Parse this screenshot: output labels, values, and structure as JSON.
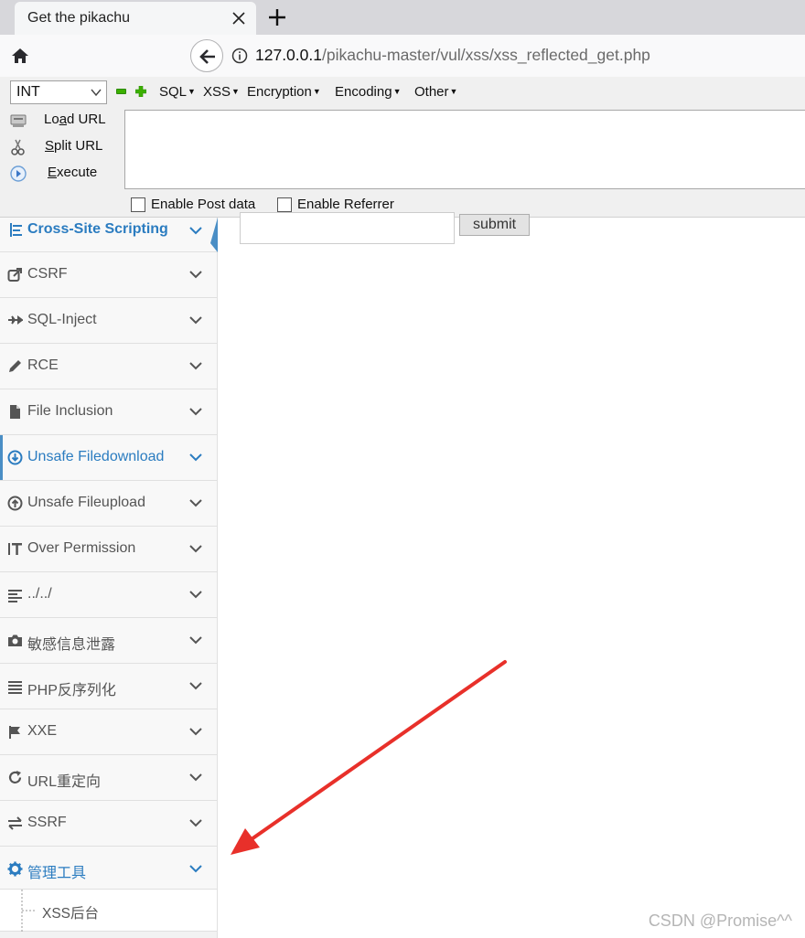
{
  "browser": {
    "tab_title": "Get the pikachu",
    "url_host": "127.0.0.1",
    "url_path": "/pikachu-master/vul/xss/xss_reflected_get.php"
  },
  "hackbar": {
    "select_value": "INT",
    "menus": [
      "SQL",
      "XSS",
      "Encryption",
      "Encoding",
      "Other"
    ],
    "actions": {
      "load_url_pre": "Lo",
      "load_url_u": "a",
      "load_url_post": "d URL",
      "split_url_u": "S",
      "split_url_post": "plit URL",
      "execute_u": "E",
      "execute_post": "xecute"
    },
    "enable_post": "Enable Post data",
    "enable_referrer": "Enable Referrer"
  },
  "sidebar": {
    "items": [
      {
        "label": "Cross-Site Scripting",
        "icon": "sitemap-icon"
      },
      {
        "label": "CSRF",
        "icon": "share-icon"
      },
      {
        "label": "SQL-Inject",
        "icon": "plane-icon"
      },
      {
        "label": "RCE",
        "icon": "pencil-icon"
      },
      {
        "label": "File Inclusion",
        "icon": "file-icon"
      },
      {
        "label": "Unsafe Filedownload",
        "icon": "download-icon"
      },
      {
        "label": "Unsafe Fileupload",
        "icon": "upload-icon"
      },
      {
        "label": "Over Permission",
        "icon": "text-height-icon"
      },
      {
        "label": "../../",
        "icon": "align-left-icon"
      },
      {
        "label": "敏感信息泄露",
        "icon": "camera-icon"
      },
      {
        "label": "PHP反序列化",
        "icon": "align-justify-icon"
      },
      {
        "label": "XXE",
        "icon": "flag-icon"
      },
      {
        "label": "URL重定向",
        "icon": "refresh-icon"
      },
      {
        "label": "SSRF",
        "icon": "exchange-icon"
      },
      {
        "label": "管理工具",
        "icon": "gear-icon"
      }
    ],
    "sub_item": "XSS后台"
  },
  "form": {
    "input_value": "",
    "submit_label": "submit"
  },
  "watermark": "CSDN @Promise^^",
  "colors": {
    "link_blue": "#2b7cc0",
    "arrow_red": "#e8302a",
    "sidebar_bg": "#f8f8f8"
  }
}
